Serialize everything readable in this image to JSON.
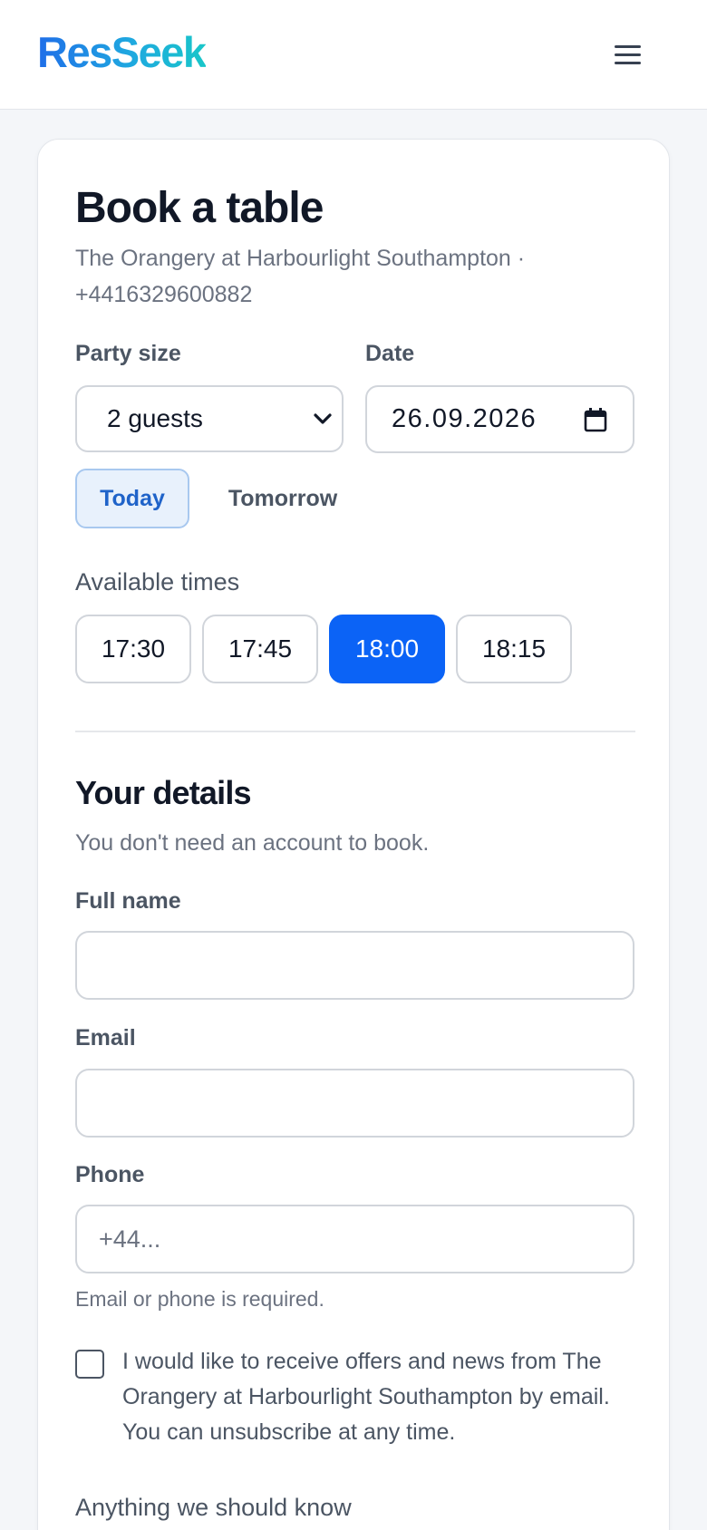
{
  "header": {
    "logo": "ResSeek",
    "menu_icon": "hamburger-menu-icon"
  },
  "booking": {
    "title": "Book a table",
    "subtitle": "The Orangery at Harbourlight Southampton · +4416329600882",
    "party_size_label": "Party size",
    "party_size_value": "2 guests",
    "date_label": "Date",
    "date_value": "26.09.2026",
    "quick_dates": [
      "Today",
      "Tomorrow"
    ],
    "quick_date_selected": "Today",
    "times_label": "Available times",
    "times": [
      "17:30",
      "17:45",
      "18:00",
      "18:15"
    ],
    "time_selected": "18:00"
  },
  "details": {
    "title": "Your details",
    "note": "You don't need an account to book.",
    "full_name_label": "Full name",
    "full_name_value": "",
    "email_label": "Email",
    "email_value": "",
    "phone_label": "Phone",
    "phone_placeholder": "+44...",
    "help_text": "Email or phone is required.",
    "marketing_opt_in_text": "I would like to receive offers and news from The Orangery at Harbourlight Southampton by email. You can unsubscribe at any time.",
    "marketing_opt_in_checked": false,
    "anything_label": "Anything we should know"
  },
  "colors": {
    "primary": "#0b63f6",
    "selected_pill_bg": "#e8f1fc",
    "selected_pill_text": "#1f63c9",
    "page_bg": "#f4f6f9"
  }
}
